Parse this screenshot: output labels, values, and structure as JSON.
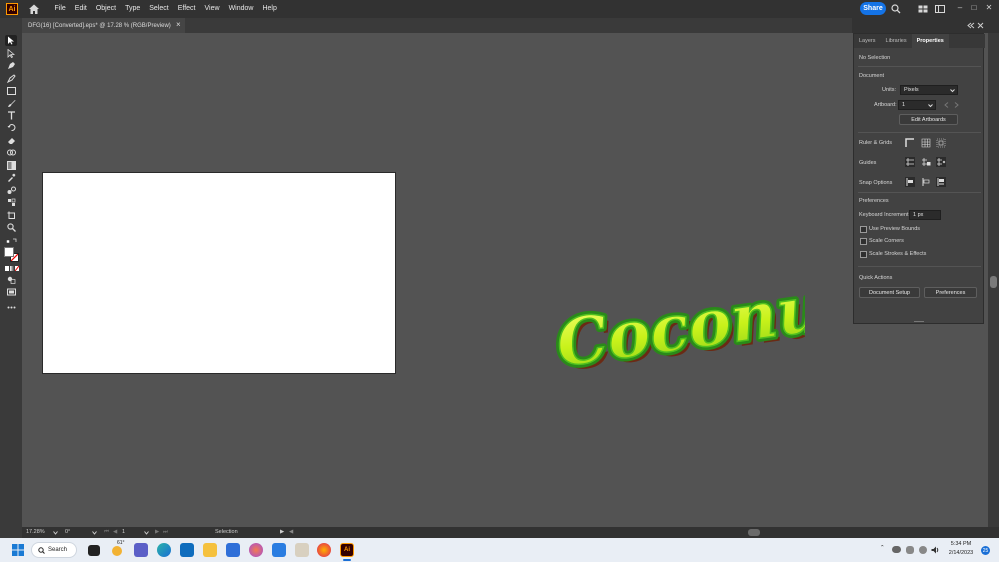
{
  "app": {
    "logo_text": "Ai",
    "menu": [
      "File",
      "Edit",
      "Object",
      "Type",
      "Select",
      "Effect",
      "View",
      "Window",
      "Help"
    ],
    "share_label": "Share",
    "window_controls": [
      "–",
      "□",
      "✕"
    ]
  },
  "document_tab": {
    "title": "DFG(16) [Converted].eps* @ 17.28 % (RGB/Preview)",
    "close": "×"
  },
  "canvas": {
    "artwork_text": "Coconut"
  },
  "panel": {
    "tabs": [
      "Layers",
      "Libraries",
      "Properties"
    ],
    "active_tab": "Properties",
    "selection_status": "No Selection",
    "document_heading": "Document",
    "units_label": "Units:",
    "units_value": "Pixels",
    "artboard_label": "Artboard:",
    "artboard_value": "1",
    "edit_artboards": "Edit Artboards",
    "ruler_grids": "Ruler & Grids",
    "guides": "Guides",
    "snap_options": "Snap Options",
    "preferences_heading": "Preferences",
    "keyboard_increment_label": "Keyboard Increment:",
    "keyboard_increment_value": "1 px",
    "checkboxes": [
      "Use Preview Bounds",
      "Scale Corners",
      "Scale Strokes & Effects"
    ],
    "quick_actions": "Quick Actions",
    "document_setup": "Document Setup",
    "preferences_button": "Preferences"
  },
  "status": {
    "zoom": "17.28%",
    "rotation": "0°",
    "artboard_num": "1",
    "tool": "Selection"
  },
  "taskbar": {
    "search_label": "Search",
    "weather": "61°",
    "time": "5:34 PM",
    "date": "2/14/2023",
    "notifications": "25"
  },
  "colors": {
    "accent": "#1473e6",
    "ui_dark": "#323232",
    "canvas": "#535353",
    "artwork_fill": "#c8f21a",
    "artwork_stroke": "#2a8a1a"
  }
}
